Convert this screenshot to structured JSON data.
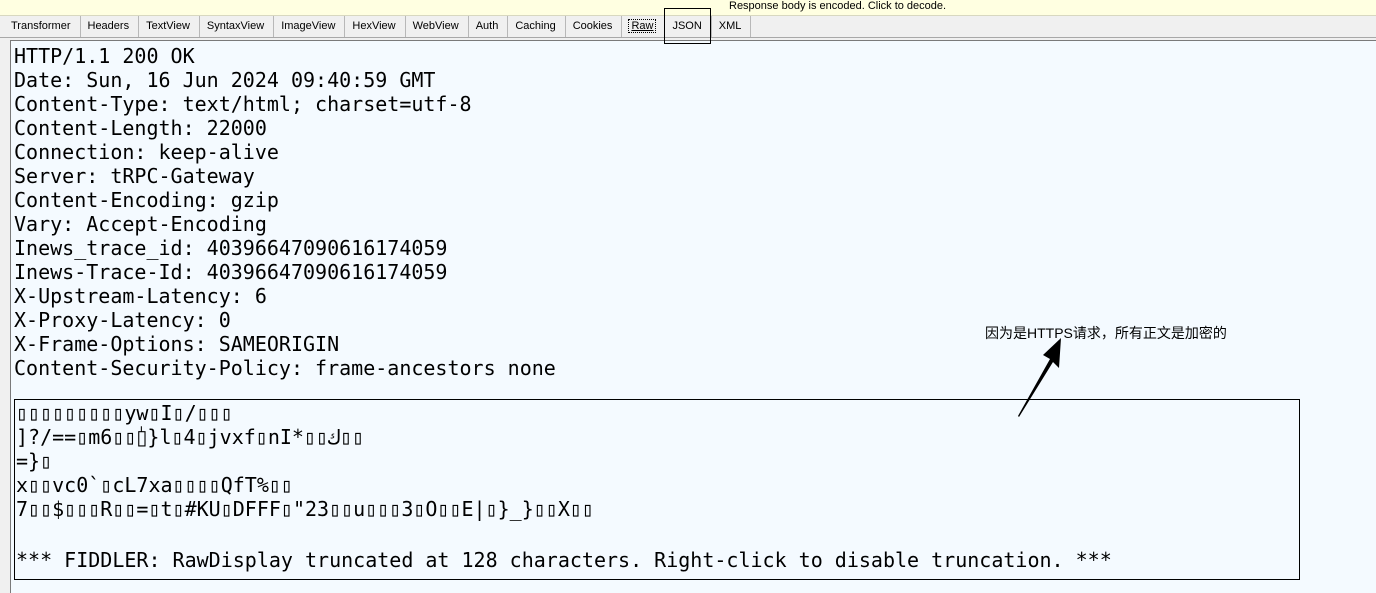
{
  "notice": {
    "text": "Response body is encoded. Click to decode."
  },
  "tabs": [
    {
      "label": "Transformer"
    },
    {
      "label": "Headers"
    },
    {
      "label": "TextView"
    },
    {
      "label": "SyntaxView"
    },
    {
      "label": "ImageView"
    },
    {
      "label": "HexView"
    },
    {
      "label": "WebView"
    },
    {
      "label": "Auth"
    },
    {
      "label": "Caching"
    },
    {
      "label": "Cookies"
    },
    {
      "label": "Raw",
      "active": true
    },
    {
      "label": "JSON"
    },
    {
      "label": "XML"
    }
  ],
  "response": {
    "headers": [
      "HTTP/1.1 200 OK",
      "Date: Sun, 16 Jun 2024 09:40:59 GMT",
      "Content-Type: text/html; charset=utf-8",
      "Content-Length: 22000",
      "Connection: keep-alive",
      "Server: tRPC-Gateway",
      "Content-Encoding: gzip",
      "Vary: Accept-Encoding",
      "Inews_trace_id: 40396647090616174059",
      "Inews-Trace-Id: 40396647090616174059",
      "X-Upstream-Latency: 6",
      "X-Proxy-Latency: 0",
      "X-Frame-Options: SAMEORIGIN",
      "Content-Security-Policy: frame-ancestors none"
    ],
    "body_lines": [
      "▯▯▯▯▯▯▯▯▯yw▯I▯/▯▯▯",
      "]?/==▯m6▯▯▯ٰ}l▯4▯jvxf▯nI*▯▯ك▯▯",
      "=}▯",
      "x▯▯vc0`▯cL7xa▯▯▯▯QfT%▯▯",
      "7▯▯$▯▯▯R▯▯=▯t▯#KU▯DFFF▯\"23▯▯u▯▯▯3▯O▯▯E|▯}_}▯▯X▯▯"
    ],
    "truncation_note": "*** FIDDLER: RawDisplay truncated at 128 characters. Right-click to disable truncation. ***"
  },
  "annotation": {
    "text": "因为是HTTPS请求，所有正文是加密的"
  }
}
